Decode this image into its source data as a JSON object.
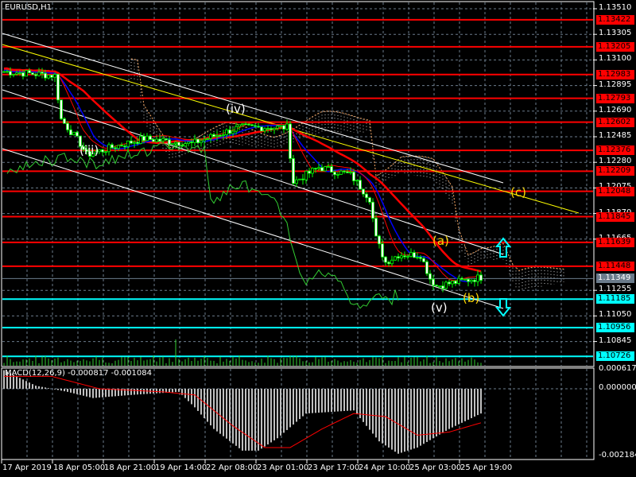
{
  "window": {
    "title": "EURUSD,H1"
  },
  "macd": {
    "label": "MACD(12,26,9) -0.000817 -0.001084",
    "ticks": [
      "0.000617",
      "0.000000",
      "-0.002184"
    ]
  },
  "price_ticks": [
    "1.13510",
    "1.13305",
    "1.13100",
    "1.12895",
    "1.12690",
    "1.12485",
    "1.12280",
    "1.12075",
    "1.11870",
    "1.11665",
    "1.11255",
    "1.11050",
    "1.10845"
  ],
  "levels": [
    {
      "label": "1.13422",
      "color": "#ff0000"
    },
    {
      "label": "1.13205",
      "color": "#ff0000"
    },
    {
      "label": "1.12983",
      "color": "#ff0000"
    },
    {
      "label": "1.12793",
      "color": "#ff0000"
    },
    {
      "label": "1.12602",
      "color": "#ff0000"
    },
    {
      "label": "1.12376",
      "color": "#ff0000"
    },
    {
      "label": "1.12209",
      "color": "#ff0000"
    },
    {
      "label": "1.12048",
      "color": "#ff0000"
    },
    {
      "label": "1.11845",
      "color": "#ff0000"
    },
    {
      "label": "1.11639",
      "color": "#ff0000"
    },
    {
      "label": "1.11448",
      "color": "#ff0000"
    },
    {
      "label": "1.11349",
      "color": "#6b7b8b"
    },
    {
      "label": "1.11185",
      "color": "#00ffff"
    },
    {
      "label": "1.10956",
      "color": "#00ffff"
    },
    {
      "label": "1.10726",
      "color": "#00ffff"
    }
  ],
  "time_labels": [
    "17 Apr 2019",
    "18 Apr 05:00",
    "18 Apr 21:00",
    "19 Apr 14:00",
    "22 Apr 08:00",
    "23 Apr 01:00",
    "23 Apr 17:00",
    "24 Apr 10:00",
    "25 Apr 03:00",
    "25 Apr 19:00"
  ],
  "waves": [
    {
      "label": "(iii)",
      "color": "#ffffff"
    },
    {
      "label": "(iv)",
      "color": "#ffffff"
    },
    {
      "label": "(v)",
      "color": "#ffffff"
    },
    {
      "label": "(a)",
      "color": "#ffd700"
    },
    {
      "label": "(b)",
      "color": "#ffd700"
    },
    {
      "label": "(c)",
      "color": "#ffd700"
    }
  ],
  "chart_data": {
    "type": "candlestick",
    "symbol": "EURUSD",
    "timeframe": "H1",
    "ylim": [
      1.107,
      1.136
    ],
    "close_waypoints": [
      [
        0,
        1.13007
      ],
      [
        16,
        1.12975
      ],
      [
        18,
        1.12625
      ],
      [
        24,
        1.1243
      ],
      [
        26,
        1.1234
      ],
      [
        34,
        1.124
      ],
      [
        44,
        1.1247
      ],
      [
        59,
        1.1243
      ],
      [
        74,
        1.1256
      ],
      [
        89,
        1.1256
      ],
      [
        91,
        1.1212
      ],
      [
        99,
        1.1224
      ],
      [
        109,
        1.1218
      ],
      [
        115,
        1.1199
      ],
      [
        117,
        1.1167
      ],
      [
        120,
        1.1148
      ],
      [
        124,
        1.1154
      ],
      [
        131,
        1.1154
      ],
      [
        134,
        1.1135
      ],
      [
        136,
        1.1129
      ],
      [
        142,
        1.1132
      ],
      [
        150,
        1.1136
      ]
    ],
    "macd_waypoints": [
      [
        0,
        0.0006
      ],
      [
        10,
        0.0001
      ],
      [
        20,
        -0.0001
      ],
      [
        28,
        -0.0003
      ],
      [
        40,
        -0.0002
      ],
      [
        55,
        -0.0001
      ],
      [
        60,
        -0.0006
      ],
      [
        66,
        -0.0013
      ],
      [
        75,
        -0.002
      ],
      [
        80,
        -0.002
      ],
      [
        86,
        -0.0016
      ],
      [
        95,
        -0.0008
      ],
      [
        110,
        -0.0007
      ],
      [
        118,
        -0.0017
      ],
      [
        124,
        -0.0021
      ],
      [
        130,
        -0.0019
      ],
      [
        140,
        -0.0013
      ],
      [
        150,
        -0.0008
      ]
    ],
    "signal_waypoints": [
      [
        15,
        0.0004
      ],
      [
        30,
        0.0
      ],
      [
        50,
        -0.0001
      ],
      [
        60,
        -0.0002
      ],
      [
        72,
        -0.0012
      ],
      [
        82,
        -0.0019
      ],
      [
        90,
        -0.0019
      ],
      [
        100,
        -0.0013
      ],
      [
        110,
        -0.0008
      ],
      [
        120,
        -0.0009
      ],
      [
        130,
        -0.0015
      ],
      [
        140,
        -0.0014
      ],
      [
        150,
        -0.0011
      ]
    ],
    "macd_ylim": [
      -0.002184,
      0.000617
    ]
  }
}
